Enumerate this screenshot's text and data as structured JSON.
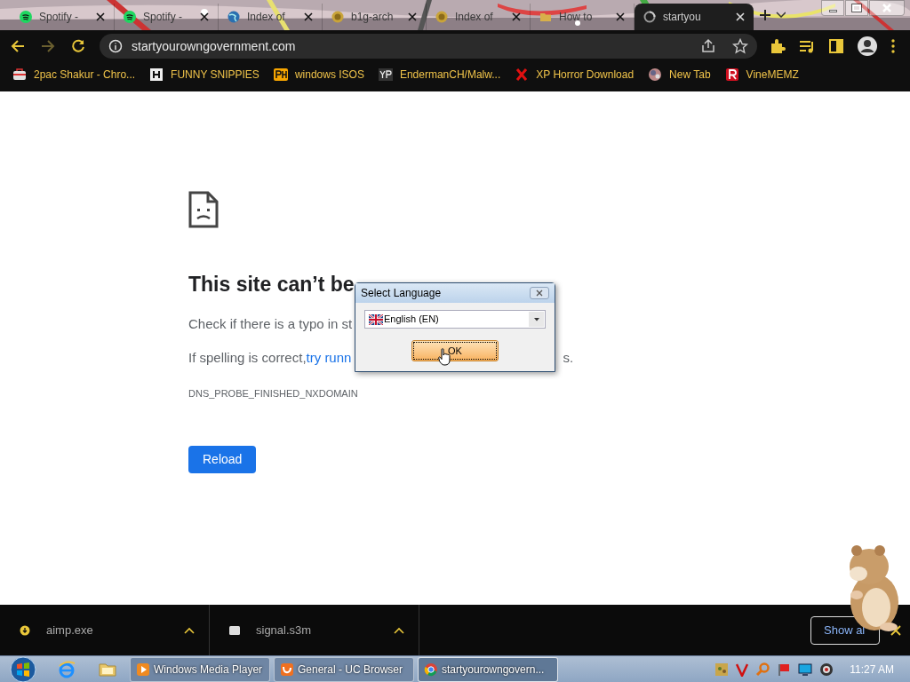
{
  "tabs": [
    {
      "title": "Spotify -",
      "selected": false
    },
    {
      "title": "Spotify -",
      "selected": false
    },
    {
      "title": "Index of",
      "selected": false
    },
    {
      "title": "b1g-arch",
      "selected": false
    },
    {
      "title": "Index of",
      "selected": false
    },
    {
      "title": "How to",
      "selected": false
    },
    {
      "title": "startyou",
      "selected": true
    }
  ],
  "address": "startyourowngovernment.com",
  "bookmarks": [
    {
      "label": "2pac Shakur - Chro..."
    },
    {
      "label": "FUNNY SNIPPIES"
    },
    {
      "label": "windows ISOS"
    },
    {
      "label": "EndermanCH/Malw..."
    },
    {
      "label": "XP Horror Download"
    },
    {
      "label": "New Tab"
    },
    {
      "label": "VineMEMZ"
    }
  ],
  "error": {
    "title": "This site can’t be",
    "line1": "Check if there is a typo in st",
    "line2": "If spelling is correct, ",
    "link": "try runn",
    "line2_end": "s.",
    "code": "DNS_PROBE_FINISHED_NXDOMAIN",
    "button": "Reload"
  },
  "dialog": {
    "title": "Select Language",
    "language": "English (EN)",
    "ok": "OK"
  },
  "downloads": [
    {
      "name": "aimp.exe",
      "kind": "exe"
    },
    {
      "name": "signal.s3m",
      "kind": "file"
    }
  ],
  "show_all": "Show al",
  "taskbar": {
    "windows": [
      {
        "title": "Windows Media Player",
        "selected": false
      },
      {
        "title": "General - UC Browser",
        "selected": false
      },
      {
        "title": "startyourowngovern...",
        "selected": true
      }
    ],
    "time": "11:27 AM"
  }
}
